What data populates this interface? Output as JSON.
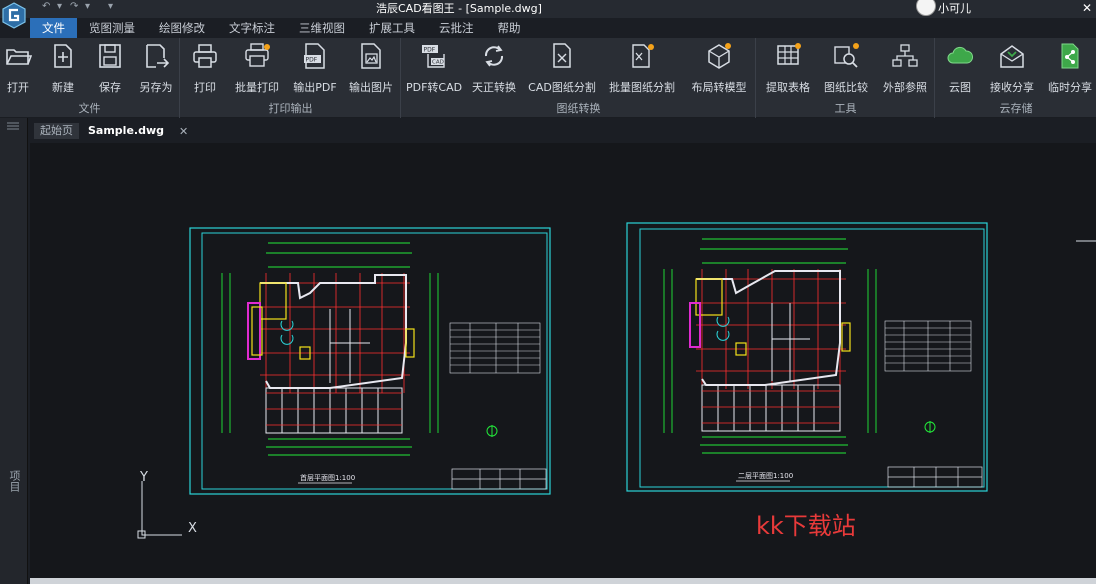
{
  "window": {
    "title": "浩辰CAD看图王 - [Sample.dwg]",
    "user_name": "小可儿",
    "quick_access": [
      "↶",
      "↷",
      "▾"
    ]
  },
  "menu": {
    "tabs": [
      "文件",
      "览图测量",
      "绘图修改",
      "文字标注",
      "三维视图",
      "扩展工具",
      "云批注",
      "帮助"
    ],
    "active_index": 0
  },
  "ribbon": {
    "groups": [
      {
        "label": "文件",
        "buttons": [
          "打开",
          "新建",
          "保存",
          "另存为"
        ]
      },
      {
        "label": "打印输出",
        "buttons": [
          "打印",
          "批量打印",
          "输出PDF",
          "输出图片"
        ]
      },
      {
        "label": "图纸转换",
        "buttons": [
          "PDF转CAD",
          "天正转换",
          "CAD图纸分割",
          "批量图纸分割",
          "布局转模型"
        ]
      },
      {
        "label": "工具",
        "buttons": [
          "提取表格",
          "图纸比较",
          "外部参照"
        ]
      },
      {
        "label": "云存储",
        "buttons": [
          "云图",
          "接收分享",
          "临时分享"
        ]
      }
    ]
  },
  "sidebar": {
    "label": "项目"
  },
  "doc_tabs": {
    "tabs": [
      "起始页",
      "Sample.dwg"
    ],
    "active_index": 1
  },
  "canvas": {
    "axis_x": "X",
    "axis_y": "Y",
    "drawing_1_title": "首层平面图1:100",
    "drawing_2_title": "二层平面图1:100"
  },
  "watermark": "kk下载站",
  "colors": {
    "accent": "#2b6fb9",
    "frame": "#2bd3d8",
    "wall": "#e8e8f0",
    "grid": "#ff3030",
    "dimension": "#22e83a",
    "yellow": "#f4e21a",
    "magenta": "#e02bd0",
    "watermark": "#e83a3a"
  }
}
